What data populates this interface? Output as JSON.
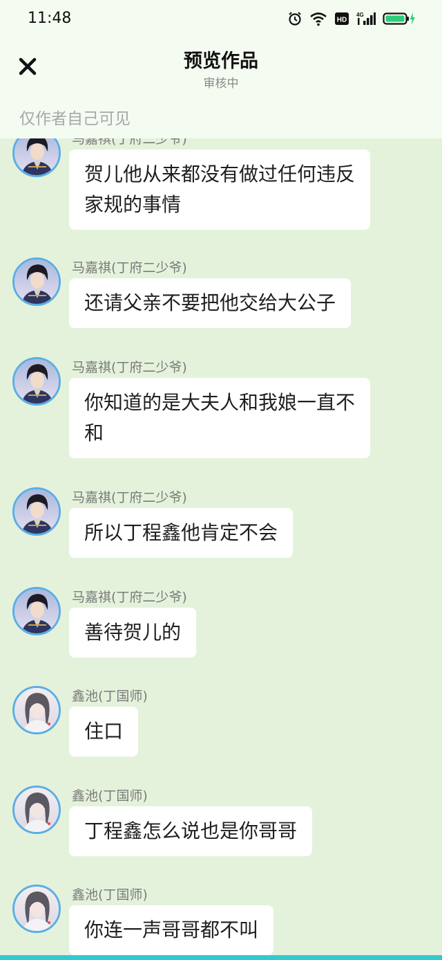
{
  "status_bar": {
    "time": "11:48",
    "hd_label": "HD",
    "network_label": "4G",
    "battery_color": "#2dcc7a"
  },
  "header": {
    "title": "预览作品",
    "subtitle": "审核中",
    "close_icon": "close-icon",
    "visibility_note": "仅作者自己可见"
  },
  "colors": {
    "chat_background": "#e4f2db",
    "header_background": "#f4fbf1",
    "avatar_border": "#5aaee6",
    "bubble_background": "#ffffff"
  },
  "messages": [
    {
      "sender": "马嘉祺(丁府二少爷)",
      "avatar": "ma-jiaqi-avatar",
      "text": "贺儿他从来都没有做过任何违反家规的事情"
    },
    {
      "sender": "马嘉祺(丁府二少爷)",
      "avatar": "ma-jiaqi-avatar",
      "text": "还请父亲不要把他交给大公子"
    },
    {
      "sender": "马嘉祺(丁府二少爷)",
      "avatar": "ma-jiaqi-avatar",
      "text": "你知道的是大夫人和我娘一直不和"
    },
    {
      "sender": "马嘉祺(丁府二少爷)",
      "avatar": "ma-jiaqi-avatar",
      "text": "所以丁程鑫他肯定不会"
    },
    {
      "sender": "马嘉祺(丁府二少爷)",
      "avatar": "ma-jiaqi-avatar",
      "text": "善待贺儿的"
    },
    {
      "sender": "鑫池(丁国师)",
      "avatar": "xin-chi-avatar",
      "text": "住口"
    },
    {
      "sender": "鑫池(丁国师)",
      "avatar": "xin-chi-avatar",
      "text": "丁程鑫怎么说也是你哥哥"
    },
    {
      "sender": "鑫池(丁国师)",
      "avatar": "xin-chi-avatar",
      "text": "你连一声哥哥都不叫"
    }
  ]
}
